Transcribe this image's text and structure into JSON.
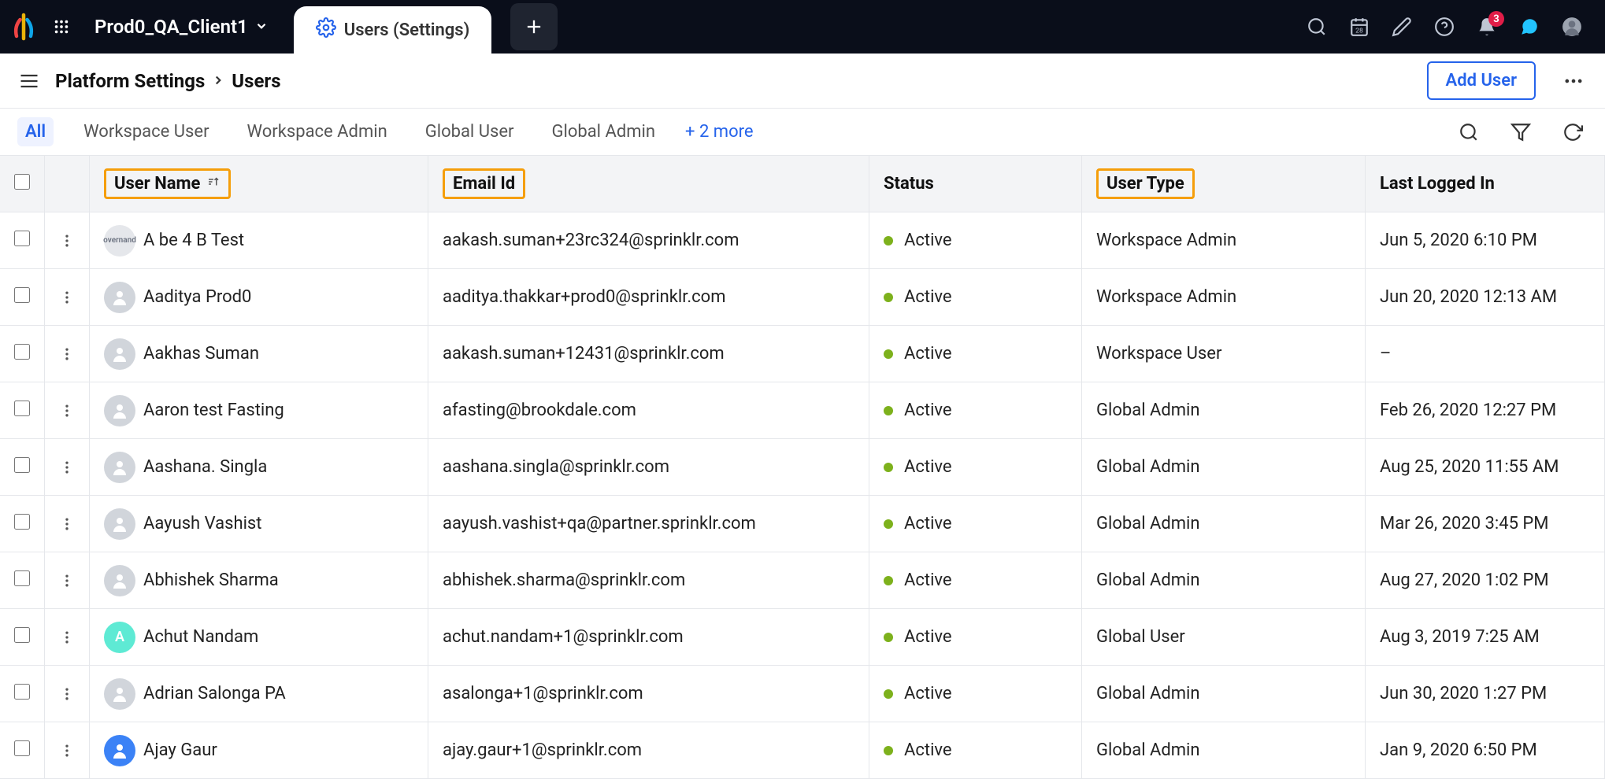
{
  "topnav": {
    "client_name": "Prod0_QA_Client1",
    "active_tab": "Users (Settings)",
    "notification_count": "3"
  },
  "subhead": {
    "crumb1": "Platform Settings",
    "crumb2": "Users",
    "add_user_label": "Add User"
  },
  "filters": {
    "tabs": [
      "All",
      "Workspace User",
      "Workspace Admin",
      "Global User",
      "Global Admin"
    ],
    "more_label": "+ 2 more"
  },
  "columns": {
    "name": "User Name",
    "email": "Email Id",
    "status": "Status",
    "type": "User Type",
    "login": "Last Logged In"
  },
  "rows": [
    {
      "name": "A be 4 B Test",
      "email": "aakash.suman+23rc324@sprinklr.com",
      "status": "Active",
      "type": "Workspace Admin",
      "login": "Jun 5, 2020 6:10 PM",
      "avatar": "gov",
      "initial": ""
    },
    {
      "name": "Aaditya Prod0",
      "email": "aaditya.thakkar+prod0@sprinklr.com",
      "status": "Active",
      "type": "Workspace Admin",
      "login": "Jun 20, 2020 12:13 AM",
      "avatar": "grey",
      "initial": ""
    },
    {
      "name": "Aakhas Suman",
      "email": "aakash.suman+12431@sprinklr.com",
      "status": "Active",
      "type": "Workspace User",
      "login": "–",
      "avatar": "grey",
      "initial": ""
    },
    {
      "name": "Aaron test Fasting",
      "email": "afasting@brookdale.com",
      "status": "Active",
      "type": "Global Admin",
      "login": "Feb 26, 2020 12:27 PM",
      "avatar": "grey",
      "initial": ""
    },
    {
      "name": "Aashana. Singla",
      "email": "aashana.singla@sprinklr.com",
      "status": "Active",
      "type": "Global Admin",
      "login": "Aug 25, 2020 11:55 AM",
      "avatar": "grey",
      "initial": ""
    },
    {
      "name": "Aayush Vashist",
      "email": "aayush.vashist+qa@partner.sprinklr.com",
      "status": "Active",
      "type": "Global Admin",
      "login": "Mar 26, 2020 3:45 PM",
      "avatar": "grey",
      "initial": ""
    },
    {
      "name": "Abhishek Sharma",
      "email": "abhishek.sharma@sprinklr.com",
      "status": "Active",
      "type": "Global Admin",
      "login": "Aug 27, 2020 1:02 PM",
      "avatar": "grey",
      "initial": ""
    },
    {
      "name": "Achut Nandam",
      "email": "achut.nandam+1@sprinklr.com",
      "status": "Active",
      "type": "Global User",
      "login": "Aug 3, 2019 7:25 AM",
      "avatar": "teal",
      "initial": "A"
    },
    {
      "name": "Adrian Salonga PA",
      "email": "asalonga+1@sprinklr.com",
      "status": "Active",
      "type": "Global Admin",
      "login": "Jun 30, 2020 1:27 PM",
      "avatar": "grey",
      "initial": ""
    },
    {
      "name": "Ajay Gaur",
      "email": "ajay.gaur+1@sprinklr.com",
      "status": "Active",
      "type": "Global Admin",
      "login": "Jan 9, 2020 6:50 PM",
      "avatar": "blue",
      "initial": ""
    }
  ]
}
